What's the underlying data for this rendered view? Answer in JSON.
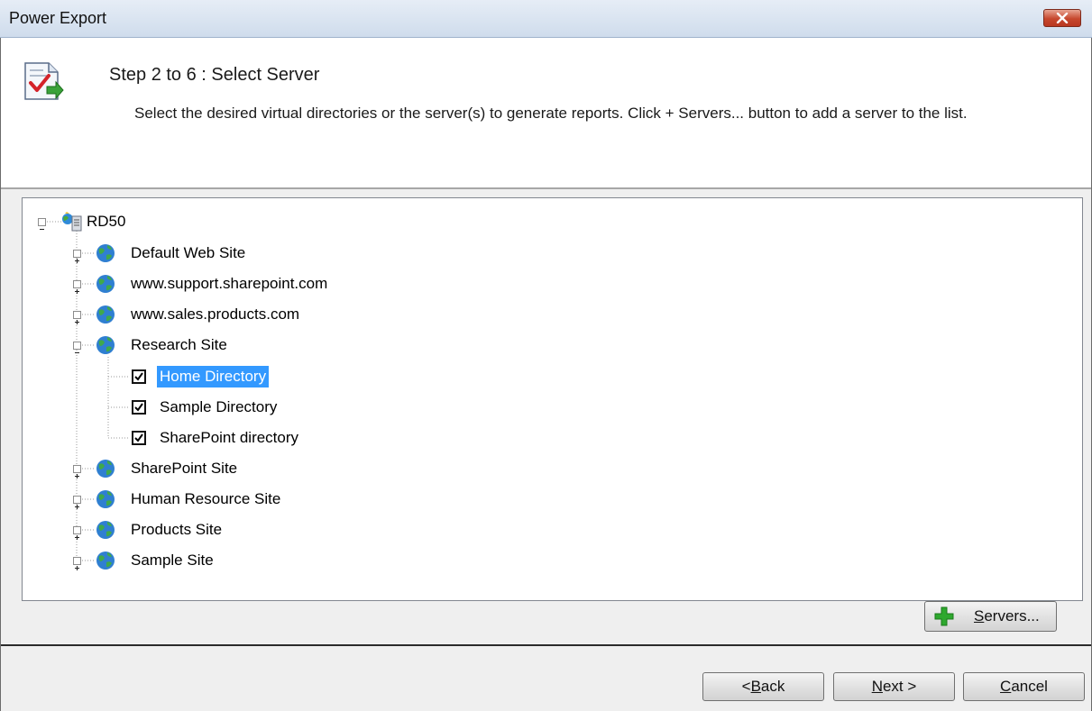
{
  "window": {
    "title": "Power Export"
  },
  "header": {
    "step_title": "Step 2 to 6 : Select Server",
    "description": "Select the desired virtual directories or the server(s) to generate reports. Click + Servers... button to add a server to the list."
  },
  "tree": {
    "root": {
      "label": "RD50",
      "icon": "server-icon",
      "expanded": true
    },
    "sites": [
      {
        "label": "Default Web Site",
        "expanded": false
      },
      {
        "label": "www.support.sharepoint.com",
        "expanded": false
      },
      {
        "label": "www.sales.products.com",
        "expanded": false
      },
      {
        "label": "Research Site",
        "expanded": true,
        "children": [
          {
            "label": "Home Directory",
            "checked": true,
            "selected": true
          },
          {
            "label": "Sample Directory",
            "checked": true,
            "selected": false
          },
          {
            "label": "SharePoint directory",
            "checked": true,
            "selected": false
          }
        ]
      },
      {
        "label": "SharePoint Site",
        "expanded": false
      },
      {
        "label": "Human Resource Site",
        "expanded": false
      },
      {
        "label": "Products Site",
        "expanded": false
      },
      {
        "label": "Sample Site",
        "expanded": false
      }
    ]
  },
  "buttons": {
    "servers": {
      "label": "Servers...",
      "mnemonic": "S",
      "rest": "ervers...",
      "icon": "plus-icon"
    },
    "back": {
      "label": "<Back",
      "prefix": "<",
      "mnemonic": "B",
      "rest": "ack"
    },
    "next": {
      "label": "Next >",
      "mnemonic": "N",
      "rest": "ext >"
    },
    "cancel": {
      "label": "Cancel",
      "mnemonic": "C",
      "rest": "ancel"
    }
  },
  "colors": {
    "selection": "#3399ff",
    "close_button": "#c6472d",
    "plus_icon": "#2ea82e"
  }
}
